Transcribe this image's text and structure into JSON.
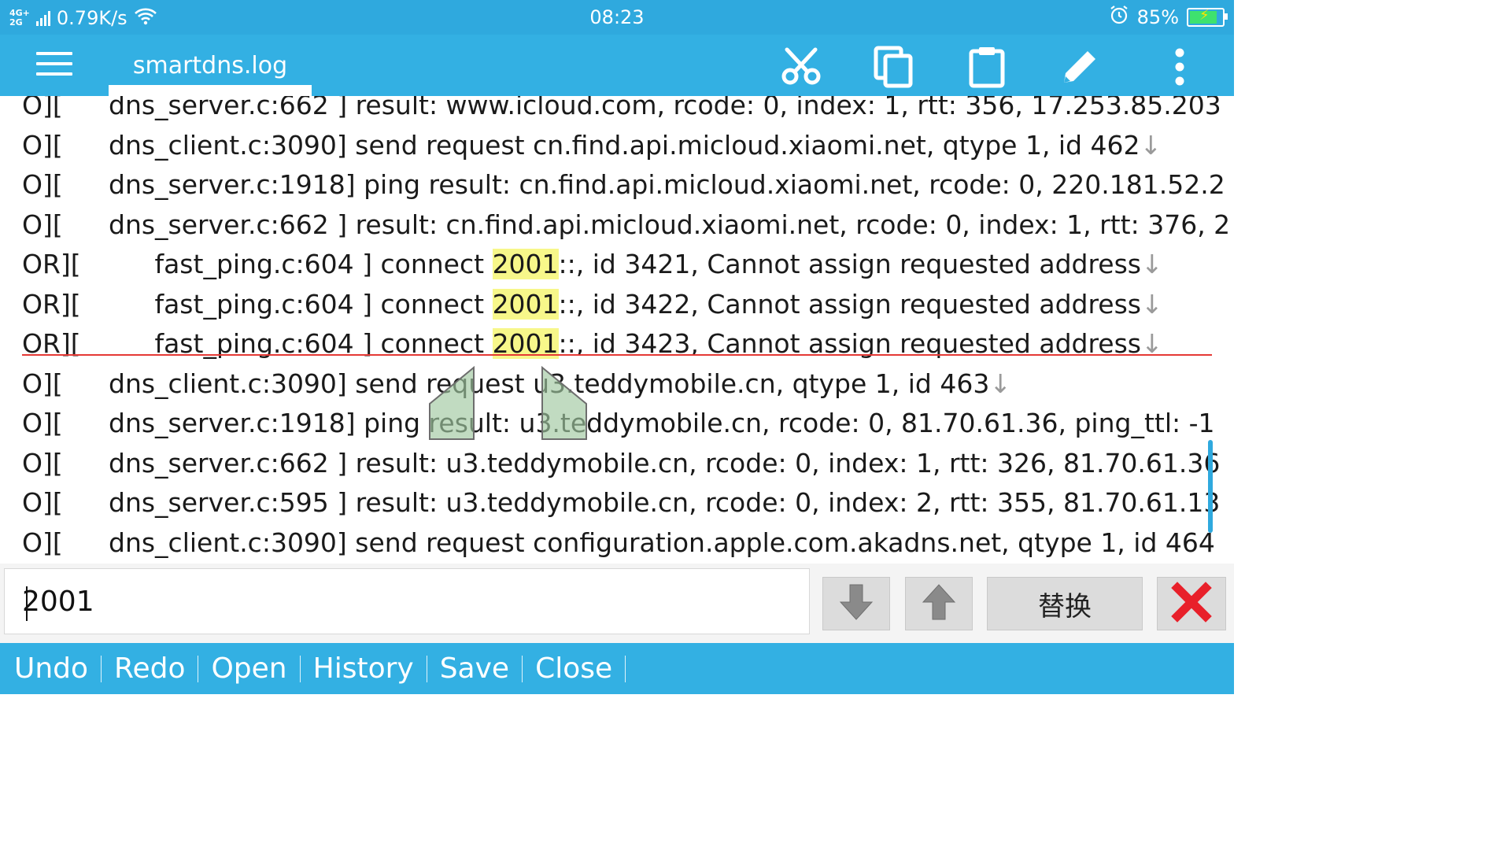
{
  "status_bar": {
    "network_type": "4G+\n2G",
    "speed": "0.79K/s",
    "time": "08:23",
    "battery": "85%",
    "battery_level": 0.85
  },
  "toolbar": {
    "file_tab": "smartdns.log"
  },
  "editor": {
    "lines": [
      {
        "level": "O][",
        "text": "dns_server.c:662 ] result: www.icloud.com, rcode: 0, index: 1, rtt: 356, 17.253.85.203",
        "eol": ""
      },
      {
        "level": "O][",
        "text": "dns_client.c:3090] send request cn.find.api.micloud.xiaomi.net, qtype 1, id 462",
        "eol": "↓"
      },
      {
        "level": "O][",
        "text": "dns_server.c:1918] ping result: cn.find.api.micloud.xiaomi.net, rcode: 0, 220.181.52.2",
        "eol": ""
      },
      {
        "level": "O][",
        "text": "dns_server.c:662 ] result: cn.find.api.micloud.xiaomi.net, rcode: 0, index: 1, rtt: 376, 2",
        "eol": ""
      },
      {
        "level": "OR][",
        "pre": "   fast_ping.c:604 ] connect ",
        "match": "2001",
        "post": "::, id 3421, Cannot assign requested address",
        "eol": "↓"
      },
      {
        "level": "OR][",
        "pre": "   fast_ping.c:604 ] connect ",
        "match": "2001",
        "post": "::, id 3422, Cannot assign requested address",
        "eol": "↓"
      },
      {
        "level": "OR][",
        "pre": "   fast_ping.c:604 ] connect ",
        "match": "2001",
        "post": "::, id 3423, Cannot assign requested address",
        "eol": "↓"
      },
      {
        "level": "O][",
        "text": "dns_client.c:3090] send request u3.teddymobile.cn, qtype 1, id 463",
        "eol": "↓"
      },
      {
        "level": "O][",
        "text": "dns_server.c:1918] ping result: u3.teddymobile.cn, rcode: 0, 81.70.61.36, ping_ttl: -1",
        "eol": ""
      },
      {
        "level": "O][",
        "text": "dns_server.c:662 ] result: u3.teddymobile.cn, rcode: 0, index: 1, rtt: 326, 81.70.61.36",
        "eol": ""
      },
      {
        "level": "O][",
        "text": "dns_server.c:595 ] result: u3.teddymobile.cn, rcode: 0, index: 2, rtt: 355, 81.70.61.13",
        "eol": ""
      },
      {
        "level": "O][",
        "text": "dns_client.c:3090] send request configuration.apple.com.akadns.net, qtype 1, id 464",
        "eol": ""
      }
    ]
  },
  "search": {
    "value": "2001",
    "replace_label": "替换"
  },
  "bottom_bar": {
    "items": [
      "Undo",
      "Redo",
      "Open",
      "History",
      "Save",
      "Close"
    ]
  },
  "colors": {
    "accent": "#33b0e3",
    "status_bar": "#2fa9de",
    "highlight": "#f7f78a",
    "close_red": "#e8202a",
    "cursor_line": "#e53935"
  }
}
